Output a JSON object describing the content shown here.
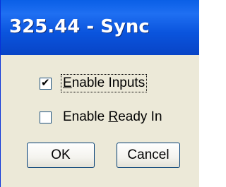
{
  "window": {
    "title": "325.44 - Sync"
  },
  "checkboxes": [
    {
      "label_pre": "",
      "label_ul": "E",
      "label_post": "nable Inputs",
      "checked": true,
      "check_glyph": "✔"
    },
    {
      "label_pre": "Enable ",
      "label_ul": "R",
      "label_post": "eady In",
      "checked": false,
      "check_glyph": ""
    }
  ],
  "buttons": {
    "ok_label": "OK",
    "cancel_label": "Cancel"
  },
  "colors": {
    "titlebar": "#0a54dd",
    "dialog_face": "#ece9d8",
    "title_text": "#ffffff"
  }
}
